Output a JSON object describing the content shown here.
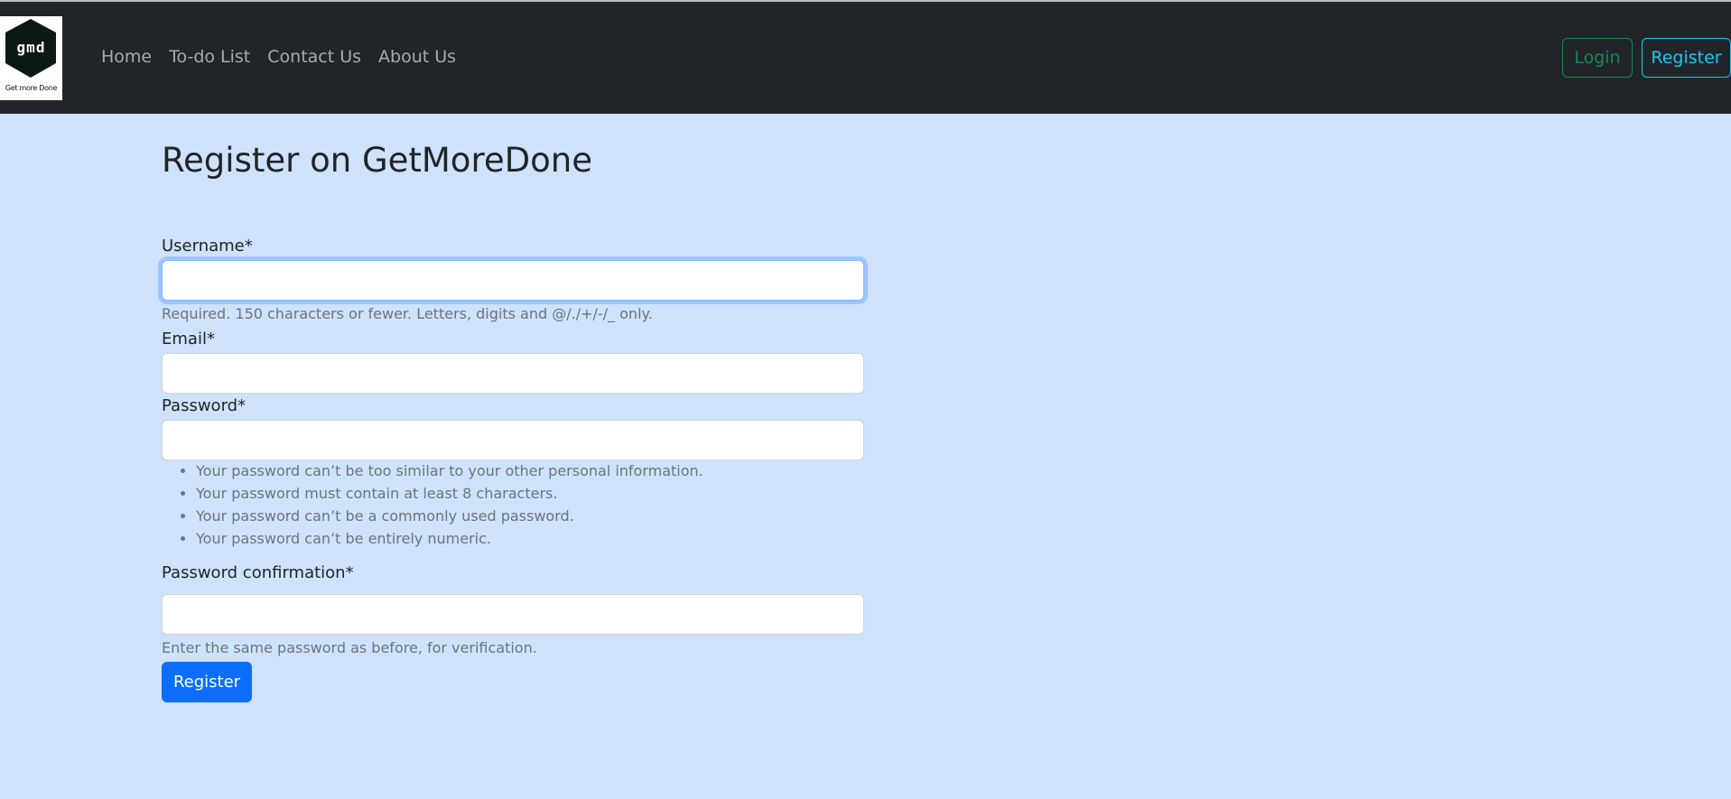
{
  "nav": {
    "logo_text": "gmd",
    "logo_caption": "Get more Done",
    "links": [
      "Home",
      "To-do List",
      "Contact Us",
      "About Us"
    ],
    "login_label": "Login",
    "register_label": "Register"
  },
  "page": {
    "title": "Register on GetMoreDone"
  },
  "form": {
    "username_label": "Username*",
    "username_value": "",
    "username_help": "Required. 150 characters or fewer. Letters, digits and @/./+/-/_ only.",
    "email_label": "Email*",
    "email_value": "",
    "password_label": "Password*",
    "password_value": "",
    "password_rules": [
      "Your password can’t be too similar to your other personal information.",
      "Your password must contain at least 8 characters.",
      "Your password can’t be a commonly used password.",
      "Your password can’t be entirely numeric."
    ],
    "password_confirm_label": "Password confirmation*",
    "password_confirm_value": "",
    "password_confirm_help": "Enter the same password as before, for verification.",
    "submit_label": "Register"
  },
  "colors": {
    "navbar_bg": "#212529",
    "page_bg": "#cfe2fb",
    "primary": "#0d6efd",
    "success": "#198754",
    "info": "#0dcaf0"
  }
}
